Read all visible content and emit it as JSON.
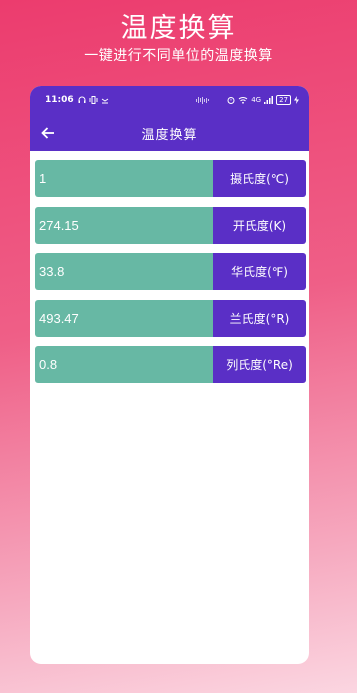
{
  "promo": {
    "title": "温度换算",
    "subtitle": "一键进行不同单位的温度换算"
  },
  "status_bar": {
    "time": "11:06",
    "left_icons": [
      "headset-icon",
      "vibrate-icon",
      "notification-icon"
    ],
    "right_icons": [
      "alarm-icon",
      "wifi-icon",
      "signal-icon",
      "battery-icon"
    ],
    "network_label": "4G",
    "battery_level": "27"
  },
  "app": {
    "title": "温度换算",
    "back_icon": "arrow-left-icon"
  },
  "conversions": [
    {
      "value": "1",
      "unit": "摄氏度(℃)"
    },
    {
      "value": "274.15",
      "unit": "开氏度(K)"
    },
    {
      "value": "33.8",
      "unit": "华氏度(℉)"
    },
    {
      "value": "493.47",
      "unit": "兰氏度(°R)"
    },
    {
      "value": "0.8",
      "unit": "列氏度(°Re)"
    }
  ],
  "colors": {
    "accent": "#5a2fc6",
    "value_bg": "#67b8a4",
    "background_top": "#ec3c6e",
    "background_bottom": "#fbd6e1"
  }
}
